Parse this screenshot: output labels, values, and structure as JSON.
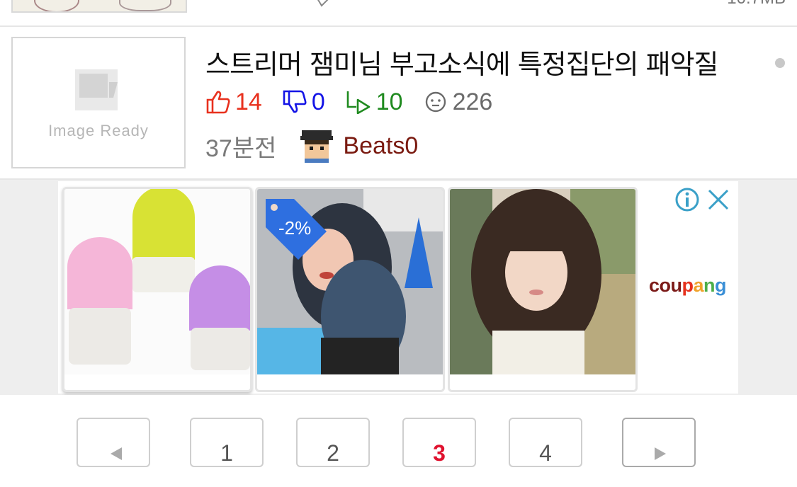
{
  "top_item": {
    "size_text": "10.7MB"
  },
  "post": {
    "thumbnail_label": "Image Ready",
    "title": "스트리머 잼미님 부고소식에 특정집단의 패악질",
    "upvotes": "14",
    "downvotes": "0",
    "replies": "10",
    "views": "226",
    "time": "37분전",
    "author": "Beats0"
  },
  "ad": {
    "discount_tag": "-2%",
    "brand_parts": [
      "cou",
      "p",
      "a",
      "n",
      "g"
    ],
    "brand_colors": [
      "#7b1a18",
      "#e6321e",
      "#f0a32a",
      "#4cae4a",
      "#3a8fd6"
    ]
  },
  "pagination": {
    "pages": [
      "1",
      "2",
      "3",
      "4"
    ],
    "current": "3",
    "prev": "◀",
    "next": "▶"
  },
  "colors": {
    "upvote": "#e8311e",
    "downvote": "#1414e6",
    "reply": "#1f8a1f",
    "author": "#7a1a10",
    "current_page": "#e0122f",
    "ad_icon": "#3aa0c8"
  }
}
